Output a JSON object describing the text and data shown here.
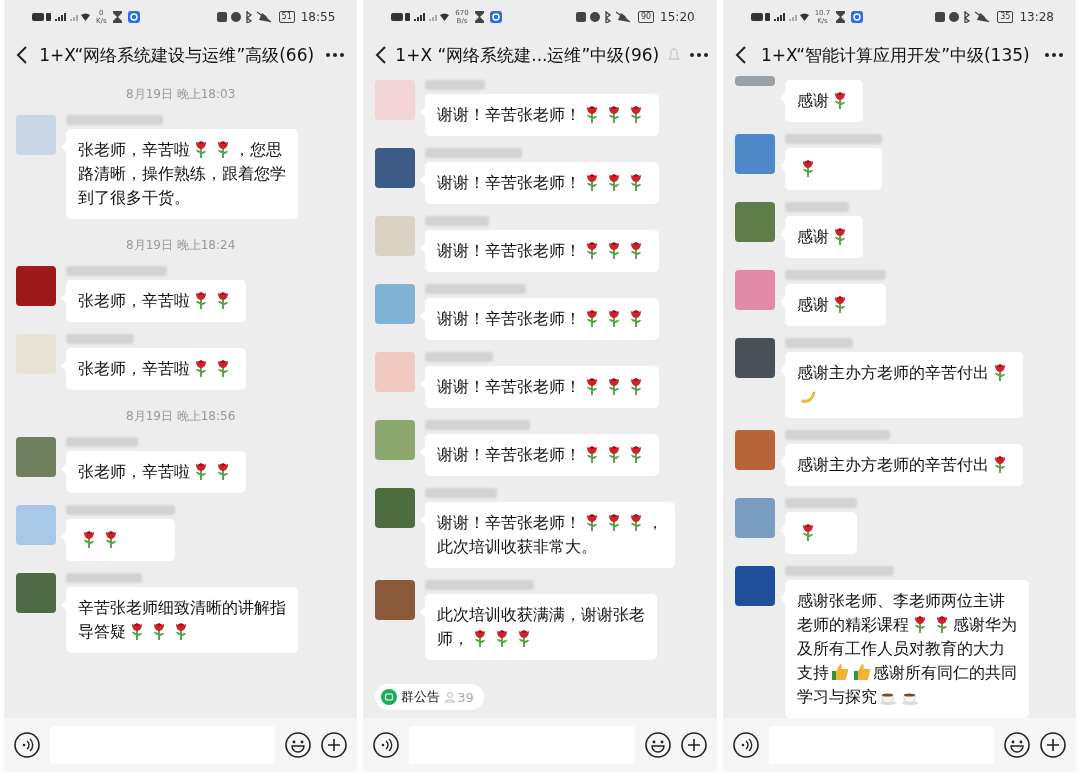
{
  "phones": [
    {
      "status": {
        "speed": [
          "0",
          "K/s"
        ],
        "battery": "51",
        "time": "18:55"
      },
      "title": "1+X“网络系统建设与运维”高级(66)",
      "items": [
        {
          "kind": "time",
          "text": "8月19日 晚上18:03"
        },
        {
          "kind": "message",
          "avatar": {
            "color": "#c9d6e6"
          },
          "lines": [
            [
              {
                "kind": "text",
                "text": "张老师，辛苦啦"
              },
              {
                "kind": "rose"
              },
              {
                "kind": "rose"
              },
              {
                "kind": "text",
                "text": "，您思"
              }
            ],
            [
              {
                "kind": "text",
                "text": "路清晰，操作熟练，跟着您学"
              }
            ],
            [
              {
                "kind": "text",
                "text": "到了很多干货。"
              }
            ]
          ]
        },
        {
          "kind": "time",
          "text": "8月19日 晚上18:24"
        },
        {
          "kind": "message",
          "avatar": {
            "color": "#9e1a1a"
          },
          "lines": [
            [
              {
                "kind": "text",
                "text": "张老师，辛苦啦"
              },
              {
                "kind": "rose"
              },
              {
                "kind": "rose"
              }
            ]
          ]
        },
        {
          "kind": "message",
          "avatar": {
            "color": "#e8e3d6"
          },
          "lines": [
            [
              {
                "kind": "text",
                "text": "张老师，辛苦啦"
              },
              {
                "kind": "rose"
              },
              {
                "kind": "rose"
              }
            ]
          ]
        },
        {
          "kind": "time",
          "text": "8月19日 晚上18:56"
        },
        {
          "kind": "message",
          "avatar": {
            "color": "#6f7e5c"
          },
          "lines": [
            [
              {
                "kind": "text",
                "text": "张老师，辛苦啦"
              },
              {
                "kind": "rose"
              },
              {
                "kind": "rose"
              }
            ]
          ]
        },
        {
          "kind": "message",
          "avatar": {
            "color": "#a9c8e8"
          },
          "lines": [
            [
              {
                "kind": "rose"
              },
              {
                "kind": "rose"
              }
            ]
          ]
        },
        {
          "kind": "message",
          "avatar": {
            "color": "#4e6b45"
          },
          "lines": [
            [
              {
                "kind": "text",
                "text": "辛苦张老师细致清晰的讲解指"
              }
            ],
            [
              {
                "kind": "text",
                "text": "导答疑"
              },
              {
                "kind": "rose"
              },
              {
                "kind": "rose"
              },
              {
                "kind": "rose"
              }
            ]
          ]
        }
      ]
    },
    {
      "status": {
        "speed": [
          "670",
          "B/s"
        ],
        "battery": "90",
        "time": "15:20"
      },
      "title": "1+X “网络系统建...运维”中级(96)",
      "header_extra_icon": true,
      "items": [
        {
          "kind": "message",
          "avatar": {
            "color": "#f2d3d6"
          },
          "lines": [
            [
              {
                "kind": "text",
                "text": "谢谢！辛苦张老师！"
              },
              {
                "kind": "rose"
              },
              {
                "kind": "rose"
              },
              {
                "kind": "rose"
              }
            ]
          ]
        },
        {
          "kind": "message",
          "avatar": {
            "color": "#3c5a86"
          },
          "lines": [
            [
              {
                "kind": "text",
                "text": "谢谢！辛苦张老师！"
              },
              {
                "kind": "rose"
              },
              {
                "kind": "rose"
              },
              {
                "kind": "rose"
              }
            ]
          ]
        },
        {
          "kind": "message",
          "avatar": {
            "color": "#d9d2c2"
          },
          "lines": [
            [
              {
                "kind": "text",
                "text": "谢谢！辛苦张老师！"
              },
              {
                "kind": "rose"
              },
              {
                "kind": "rose"
              },
              {
                "kind": "rose"
              }
            ]
          ]
        },
        {
          "kind": "message",
          "avatar": {
            "color": "#7fb4d6"
          },
          "lines": [
            [
              {
                "kind": "text",
                "text": "谢谢！辛苦张老师！"
              },
              {
                "kind": "rose"
              },
              {
                "kind": "rose"
              },
              {
                "kind": "rose"
              }
            ]
          ]
        },
        {
          "kind": "message",
          "avatar": {
            "color": "#f0c9c0"
          },
          "lines": [
            [
              {
                "kind": "text",
                "text": "谢谢！辛苦张老师！"
              },
              {
                "kind": "rose"
              },
              {
                "kind": "rose"
              },
              {
                "kind": "rose"
              }
            ]
          ]
        },
        {
          "kind": "message",
          "avatar": {
            "color": "#8da86e"
          },
          "lines": [
            [
              {
                "kind": "text",
                "text": "谢谢！辛苦张老师！"
              },
              {
                "kind": "rose"
              },
              {
                "kind": "rose"
              },
              {
                "kind": "rose"
              }
            ]
          ]
        },
        {
          "kind": "message",
          "avatar": {
            "color": "#4f6e3f"
          },
          "lines": [
            [
              {
                "kind": "text",
                "text": "谢谢！辛苦张老师！"
              },
              {
                "kind": "rose"
              },
              {
                "kind": "rose"
              },
              {
                "kind": "rose"
              },
              {
                "kind": "text",
                "text": "，"
              }
            ],
            [
              {
                "kind": "text",
                "text": "此次培训收获非常大。"
              }
            ]
          ]
        },
        {
          "kind": "message",
          "avatar": {
            "color": "#8a5a3a"
          },
          "lines": [
            [
              {
                "kind": "text",
                "text": "此次培训收获满满，谢谢张老"
              }
            ],
            [
              {
                "kind": "text",
                "text": "师，"
              },
              {
                "kind": "rose"
              },
              {
                "kind": "rose"
              },
              {
                "kind": "rose"
              }
            ]
          ]
        }
      ],
      "notice": {
        "label": "群公告",
        "count": "39"
      }
    },
    {
      "status": {
        "speed": [
          "10.7",
          "K/s"
        ],
        "battery": "35",
        "time": "13:28"
      },
      "title": "1+X“智能计算应用开发”中级(135)",
      "items": [
        {
          "kind": "message",
          "avatar": {
            "color": "#9aa0a8"
          },
          "top_cut": true,
          "lines": [
            [
              {
                "kind": "text",
                "text": "感谢"
              },
              {
                "kind": "rose"
              }
            ]
          ]
        },
        {
          "kind": "message",
          "avatar": {
            "color": "#4f88c8"
          },
          "lines": [
            [
              {
                "kind": "rose"
              }
            ]
          ]
        },
        {
          "kind": "message",
          "avatar": {
            "color": "#5e7d4a"
          },
          "lines": [
            [
              {
                "kind": "text",
                "text": "感谢"
              },
              {
                "kind": "rose"
              }
            ]
          ]
        },
        {
          "kind": "message",
          "avatar": {
            "color": "#e28aa8"
          },
          "lines": [
            [
              {
                "kind": "text",
                "text": "感谢"
              },
              {
                "kind": "rose"
              }
            ]
          ]
        },
        {
          "kind": "message",
          "avatar": {
            "color": "#4a5058"
          },
          "lines": [
            [
              {
                "kind": "text",
                "text": "感谢主办方老师的辛苦付出"
              },
              {
                "kind": "rose"
              }
            ],
            [
              {
                "kind": "banana"
              }
            ]
          ]
        },
        {
          "kind": "message",
          "avatar": {
            "color": "#b8643a"
          },
          "lines": [
            [
              {
                "kind": "text",
                "text": "感谢主办方老师的辛苦付出"
              },
              {
                "kind": "rose"
              }
            ]
          ]
        },
        {
          "kind": "message",
          "avatar": {
            "color": "#7a9cc0"
          },
          "lines": [
            [
              {
                "kind": "rose"
              }
            ]
          ]
        },
        {
          "kind": "message",
          "avatar": {
            "color": "#1f4e9a"
          },
          "lines": [
            [
              {
                "kind": "text",
                "text": "感谢张老师、李老师两位主讲"
              }
            ],
            [
              {
                "kind": "text",
                "text": "老师的精彩课程"
              },
              {
                "kind": "rose"
              },
              {
                "kind": "rose"
              },
              {
                "kind": "text",
                "text": "感谢华为"
              }
            ],
            [
              {
                "kind": "text",
                "text": "及所有工作人员对教育的大力"
              }
            ],
            [
              {
                "kind": "text",
                "text": "支持"
              },
              {
                "kind": "thumbs"
              },
              {
                "kind": "thumbs"
              },
              {
                "kind": "text",
                "text": "感谢所有同仁的共同"
              }
            ],
            [
              {
                "kind": "text",
                "text": "学习与探究"
              },
              {
                "kind": "coffee"
              },
              {
                "kind": "coffee"
              }
            ]
          ]
        }
      ]
    }
  ]
}
